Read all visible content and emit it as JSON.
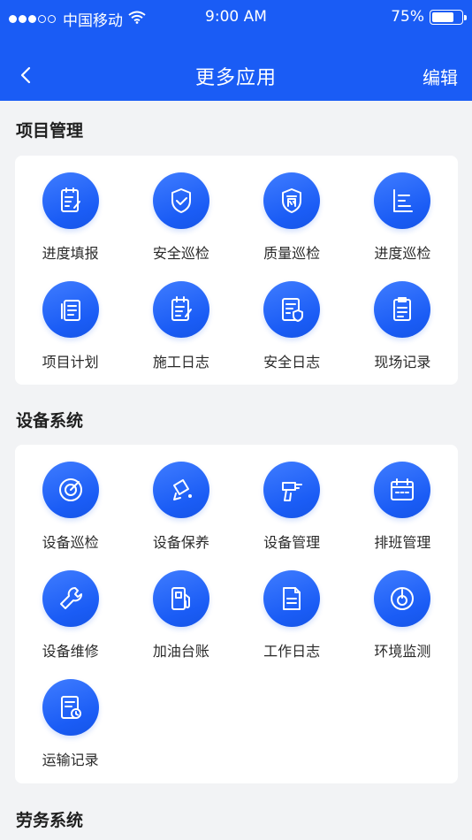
{
  "status_bar": {
    "carrier": "中国移动",
    "time": "9:00 AM",
    "battery": "75%",
    "battery_level": 0.75
  },
  "nav": {
    "title": "更多应用",
    "edit_label": "编辑"
  },
  "sections": [
    {
      "title": "项目管理",
      "apps": [
        {
          "label": "进度填报",
          "icon": "progress-report-icon"
        },
        {
          "label": "安全巡检",
          "icon": "shield-check-icon"
        },
        {
          "label": "质量巡检",
          "icon": "quality-badge-icon"
        },
        {
          "label": "进度巡检",
          "icon": "progress-bars-icon"
        },
        {
          "label": "项目计划",
          "icon": "documents-icon"
        },
        {
          "label": "施工日志",
          "icon": "construction-log-icon"
        },
        {
          "label": "安全日志",
          "icon": "safety-log-icon"
        },
        {
          "label": "现场记录",
          "icon": "clipboard-icon"
        }
      ]
    },
    {
      "title": "设备系统",
      "apps": [
        {
          "label": "设备巡检",
          "icon": "target-icon"
        },
        {
          "label": "设备保养",
          "icon": "maintenance-icon"
        },
        {
          "label": "设备管理",
          "icon": "drill-icon"
        },
        {
          "label": "排班管理",
          "icon": "calendar-icon"
        },
        {
          "label": "设备维修",
          "icon": "wrench-icon"
        },
        {
          "label": "加油台账",
          "icon": "fuel-pump-icon"
        },
        {
          "label": "工作日志",
          "icon": "work-log-icon"
        },
        {
          "label": "环境监测",
          "icon": "gauge-icon"
        },
        {
          "label": "运输记录",
          "icon": "transport-log-icon"
        }
      ]
    },
    {
      "title": "劳务系统",
      "apps": []
    }
  ],
  "colors": {
    "primary": "#1a5cf5",
    "background": "#f2f3f5"
  }
}
